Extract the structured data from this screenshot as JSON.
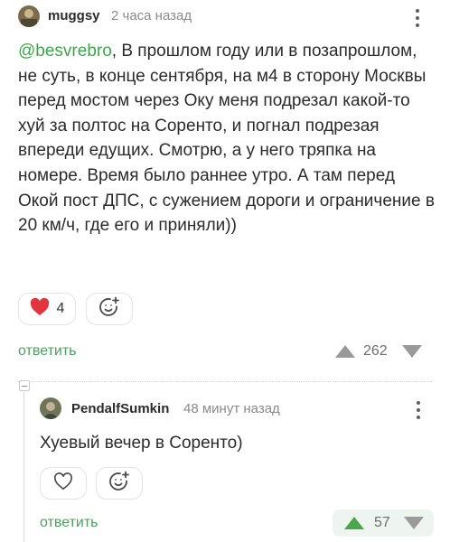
{
  "comment1": {
    "username": "muggsy",
    "time": "2 часа назад",
    "mention": "@besvrebro",
    "text": ", В прошлом году или в позапрошлом, не суть, в конце сентября, на м4 в сторону Москвы перед мостом через Оку меня подрезал какой-то хуй за полтос на Соренто, и погнал подрезая впереди едущих. Смотрю, а у него тряпка на номере. Время было раннее утро. А там перед Окой пост ДПС, с сужением дороги и ограничение в 20 км/ч, где его и приняли))",
    "like_count": "4",
    "reply_label": "ответить",
    "rating": "262"
  },
  "comment2": {
    "username": "PendalfSumkin",
    "time": "48 минут назад",
    "text": "Хуевый вечер в Соренто)",
    "reply_label": "ответить",
    "rating": "57"
  },
  "colors": {
    "accent_green": "#4f9f62",
    "heart_red": "#e2343c",
    "arrow_gray": "#9a9a9a",
    "upvote_green": "#49a64d"
  },
  "icons": {
    "heart_filled": "heart-filled-icon",
    "heart_outline": "heart-outline-icon",
    "emoji": "smile-plus-icon",
    "more": "more-vertical-icon",
    "upvote": "upvote-triangle-icon",
    "downvote": "downvote-triangle-icon"
  }
}
